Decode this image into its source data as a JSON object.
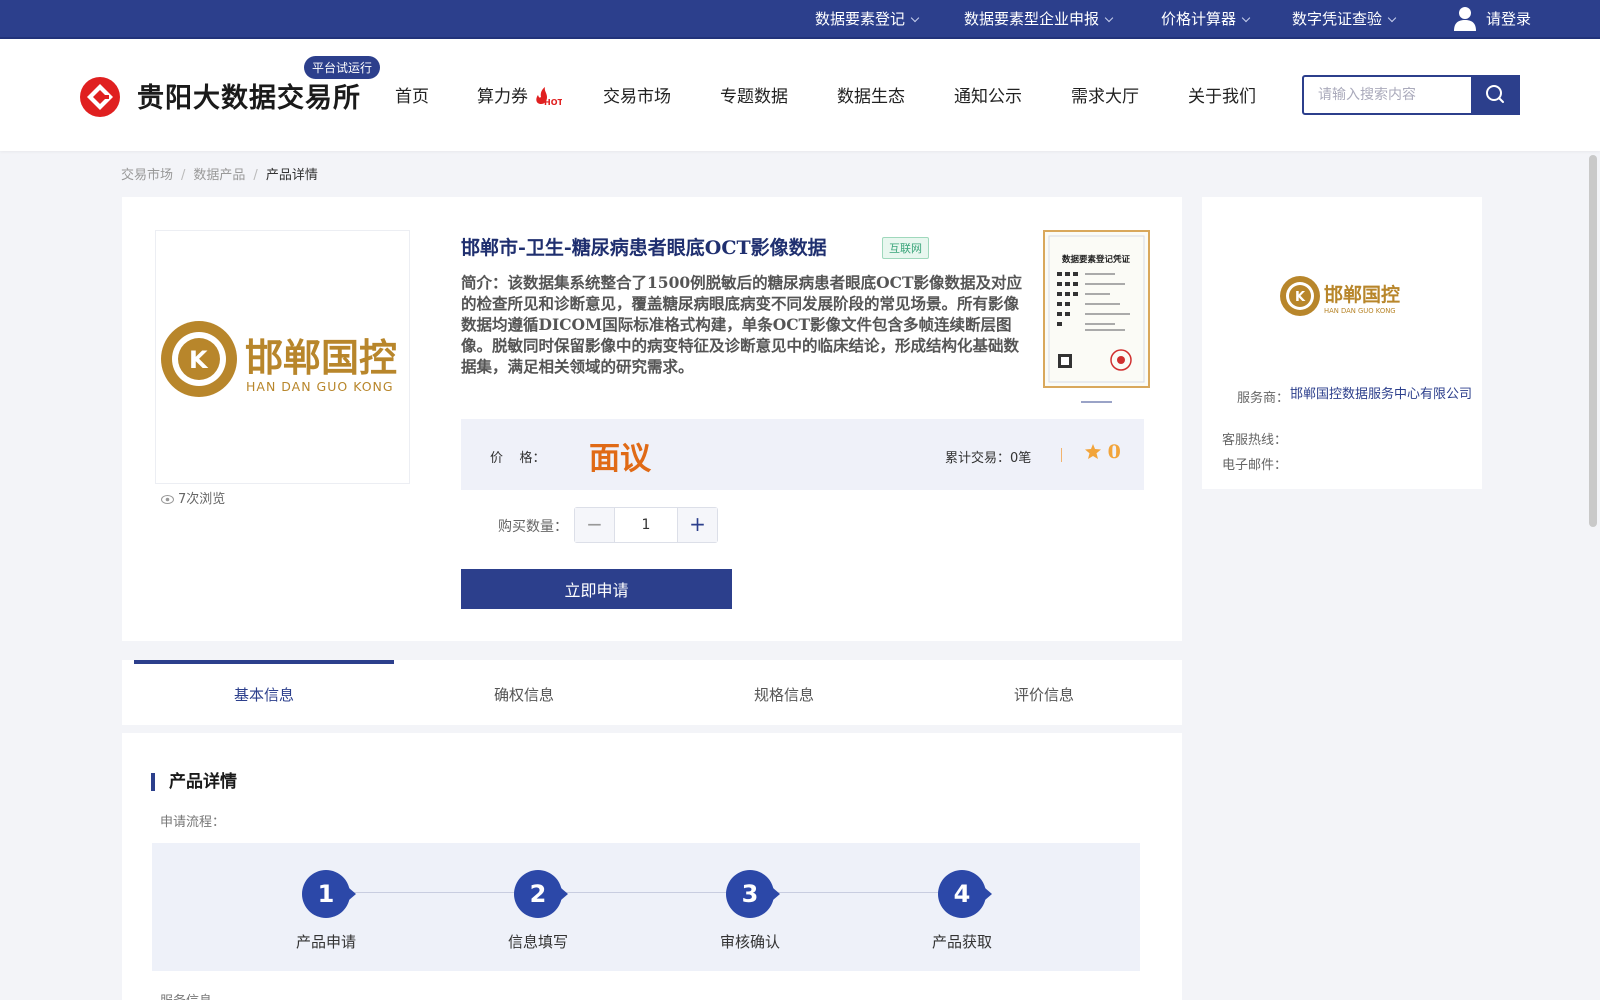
{
  "topbar": {
    "items": [
      {
        "label": "数据要素登记"
      },
      {
        "label": "数据要素型企业申报"
      },
      {
        "label": "价格计算器"
      },
      {
        "label": "数字凭证查验"
      }
    ],
    "login_label": "请登录",
    "bg_color": "#2c3f8c"
  },
  "header": {
    "brand_name": "贵阳大数据交易所",
    "trial_badge": "平台试运行",
    "nav": [
      {
        "label": "首页"
      },
      {
        "label": "算力券",
        "badge": "HOT"
      },
      {
        "label": "交易市场"
      },
      {
        "label": "专题数据"
      },
      {
        "label": "数据生态"
      },
      {
        "label": "通知公示"
      },
      {
        "label": "需求大厅"
      },
      {
        "label": "关于我们"
      }
    ],
    "search_placeholder": "请输入搜索内容"
  },
  "breadcrumb": {
    "items": [
      "交易市场",
      "数据产品",
      "产品详情"
    ]
  },
  "product": {
    "title": "邯郸市-卫生-糖尿病患者眼底OCT影像数据",
    "tag": "互联网",
    "intro": "简介：该数据集系统整合了1500例脱敏后的糖尿病患者眼底OCT影像数据及对应的检查所见和诊断意见，覆盖糖尿病眼底病变不同发展阶段的常见场景。所有影像数据均遵循DICOM国际标准格式构建，单条OCT影像文件包含多帧连续断层图像。脱敏同时保留影像中的病变特征及诊断意见中的临床结论，形成结构化基础数据集，满足相关领域的研究需求。",
    "views": "7次浏览",
    "logo_cn": "邯郸国控",
    "logo_en": "HAN DAN GUO KONG",
    "cert_title": "数据要素登记凭证",
    "price_label": "价    格：",
    "price_value": "面议",
    "trade_count": "累计交易：0笔",
    "rating": "0",
    "qty_label": "购买数量：",
    "qty_value": "1",
    "apply_label": "立即申请"
  },
  "provider": {
    "logo_cn": "邯郸国控",
    "logo_en": "HAN DAN GUO KONG",
    "service_label": "服务商：",
    "service_value": "邯郸国控数据服务中心有限公司",
    "hotline_label": "客服热线：",
    "email_label": "电子邮件："
  },
  "tabs": [
    {
      "label": "基本信息",
      "active": true
    },
    {
      "label": "确权信息"
    },
    {
      "label": "规格信息"
    },
    {
      "label": "评价信息"
    }
  ],
  "detail": {
    "section_title": "产品详情",
    "flow_label": "申请流程：",
    "steps": [
      {
        "num": "1",
        "label": "产品申请"
      },
      {
        "num": "2",
        "label": "信息填写"
      },
      {
        "num": "3",
        "label": "审核确认"
      },
      {
        "num": "4",
        "label": "产品获取"
      }
    ],
    "service_info_label": "服务信息"
  },
  "colors": {
    "primary": "#2c3f8c",
    "accent_orange": "#e06a16",
    "logo_gold": "#b8862b",
    "brand_red": "#e02020"
  }
}
